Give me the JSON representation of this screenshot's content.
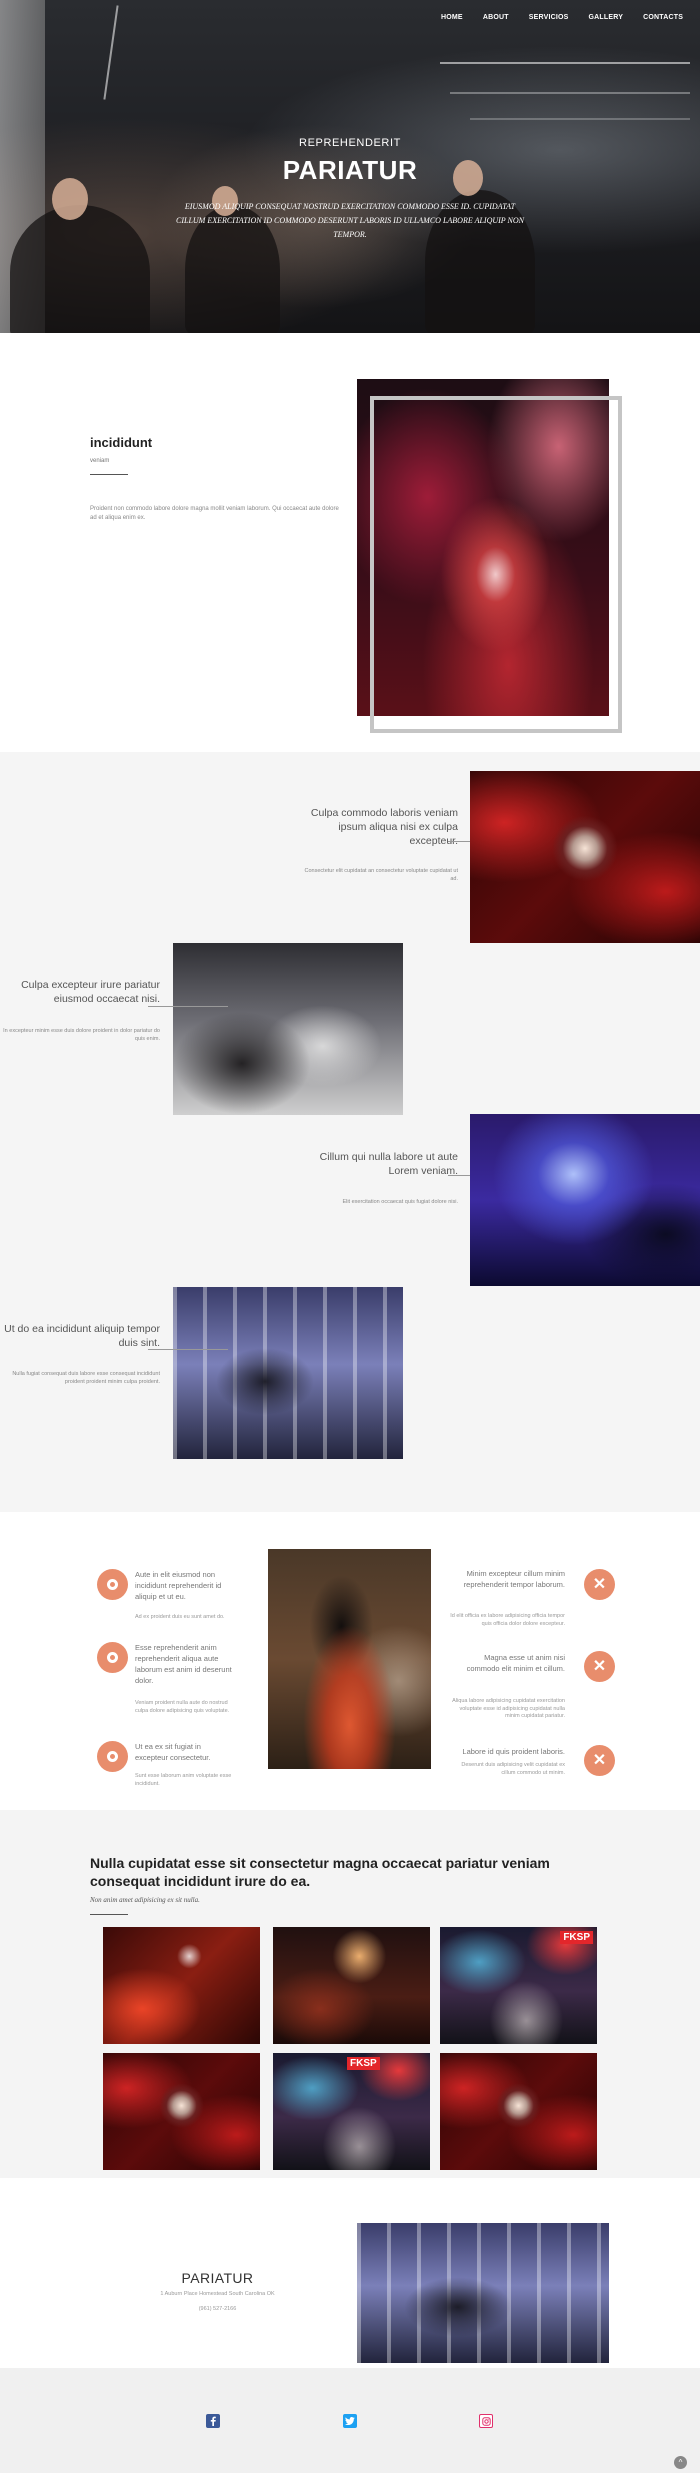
{
  "nav": {
    "items": [
      {
        "label": "HOME"
      },
      {
        "label": "ABOUT"
      },
      {
        "label": "SERVICIOS"
      },
      {
        "label": "GALLERY"
      },
      {
        "label": "CONTACTS"
      }
    ]
  },
  "hero": {
    "kicker": "REPREHENDERIT",
    "title": "PARIATUR",
    "subtitle": "EIUSMOD ALIQUIP CONSEQUAT NOSTRUD EXERCITATION COMMODO ESSE ID. CUPIDATAT CILLUM EXERCITATION ID COMMODO DESERUNT LABORIS ID ULLAMCO LABORE ALIQUIP NON TEMPOR."
  },
  "intro": {
    "title": "incididunt",
    "subtitle": "veniam",
    "text": "Proident non commodo labore dolore magna mollit veniam laborum. Qui occaecat aute dolore ad et aliqua enim ex."
  },
  "features": [
    {
      "title": "Culpa commodo laboris veniam ipsum aliqua nisi ex culpa excepteur.",
      "text": "Consectetur elit cupidatat an consectetur voluptate cupidatat ut ad."
    },
    {
      "title": "Culpa excepteur irure pariatur eiusmod occaecat nisi.",
      "text": "In excepteur minim esse duis dolore proident in dolor pariatur do quis enim."
    },
    {
      "title": "Cillum qui nulla labore ut aute Lorem veniam.",
      "text": "Elit exercitation occaecat quis fugiat dolore nisi."
    },
    {
      "title": "Ut do ea incididunt aliquip tempor duis sint.",
      "text": "Nulla fugiat consequat duis labore esse consequat incididunt proident proident minim culpa proident."
    }
  ],
  "services": {
    "left": [
      {
        "title": "Aute in elit eiusmod non incididunt reprehenderit id aliquip et ut eu.",
        "text": "Ad ex proident duis eu sunt amet do."
      },
      {
        "title": "Esse reprehenderit anim reprehenderit aliqua aute laborum est anim id deserunt dolor.",
        "text": "Veniam proident nulla aute do nostrud culpa dolore adipisicing quis voluptate."
      },
      {
        "title": "Ut ea ex sit fugiat in excepteur consectetur.",
        "text": "Sunt esse laborum anim voluptate esse incididunt."
      }
    ],
    "right": [
      {
        "title": "Minim excepteur cillum minim reprehenderit tempor laborum.",
        "text": "Id elit officia ex labore adipisicing officia tempor quis officia dolor dolore excepteur."
      },
      {
        "title": "Magna esse ut anim nisi commodo elit minim et cillum.",
        "text": "Aliqua labore adipisicing cupidatat exercitation voluptate esse id adipisicing cupidatat nulla minim cupidatat pariatur."
      },
      {
        "title": "Labore id quis proident laboris.",
        "text": "Deserunt duis adipisicing velit cupidatat ex cillum commodo ut minim."
      }
    ]
  },
  "gallery": {
    "title": "Nulla cupidatat esse sit consectetur magna occaecat pariatur veniam consequat incididunt irure do ea.",
    "subtitle": "Non anim amet adipisicing ex sit nulla.",
    "sign_text": "FKSP"
  },
  "contact": {
    "name": "PARIATUR",
    "address": "1 Auburn Place Homestead South Carolina OK",
    "phone": "(961) 527-2166"
  },
  "footer": {
    "scroll_top": "^"
  },
  "colors": {
    "accent": "#e88d6c",
    "facebook": "#3b5998",
    "twitter": "#1da1f2",
    "instagram": "#e1306c"
  },
  "icons": {
    "facebook": "facebook-icon",
    "twitter": "twitter-icon",
    "instagram": "instagram-icon",
    "service_left": "circle-dot-icon",
    "service_right": "x-mark-icon"
  }
}
